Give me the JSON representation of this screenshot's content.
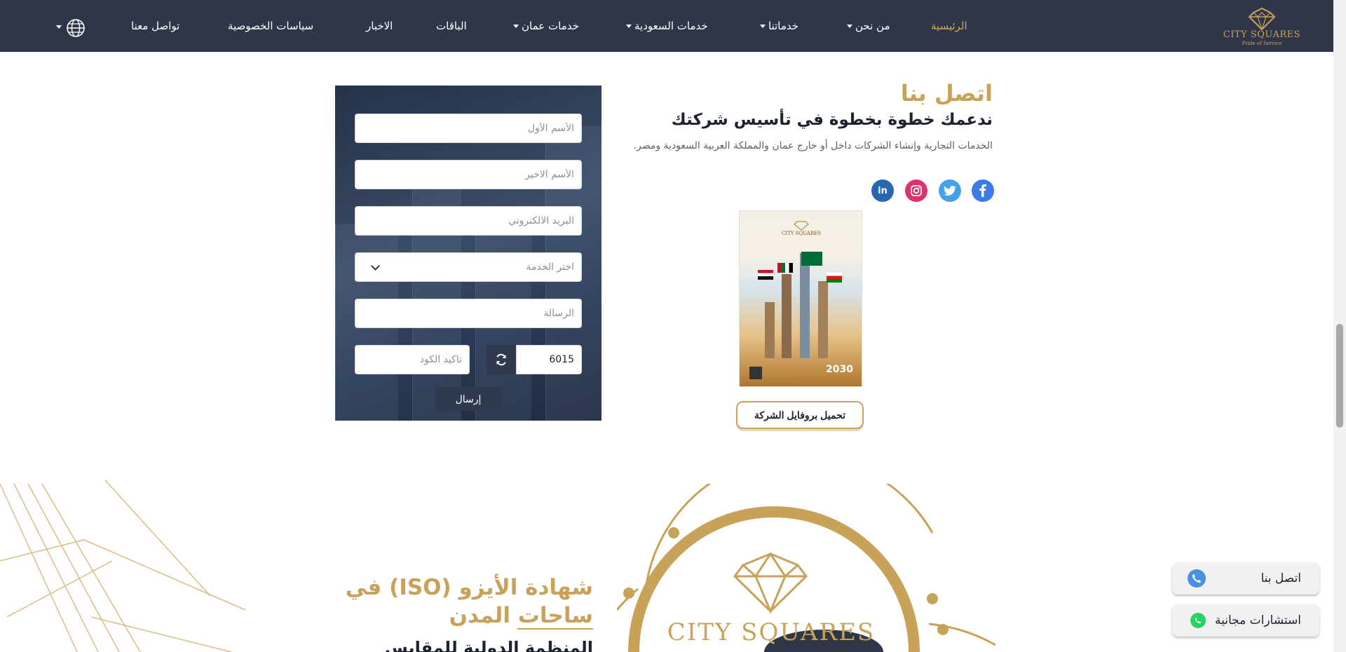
{
  "nav": {
    "brand": "CITY SQUARES",
    "tagline": "Pride of Service",
    "items": [
      {
        "label": "الرئيسية",
        "active": true
      },
      {
        "label": "من نحن",
        "dropdown": true
      },
      {
        "label": "خدماتنا",
        "dropdown": true
      },
      {
        "label": "خدمات السعودية",
        "dropdown": true
      },
      {
        "label": "خدمات عمان",
        "dropdown": true
      },
      {
        "label": "الباقات"
      },
      {
        "label": "الاخبار"
      },
      {
        "label": "سياسات الخصوصية"
      },
      {
        "label": "تواصل معنا"
      }
    ],
    "language_icon": "globe-icon"
  },
  "contact": {
    "title": "اتصل بنا",
    "subtitle": "ندعمك خطوة بخطوة في تأسيس شركتك",
    "description": "الخدمات التجارية وإنشاء الشركات داخل أو خارج عمان والمملكة العربية السعودية ومصر.",
    "socials": [
      "facebook-icon",
      "twitter-icon",
      "instagram-icon",
      "linkedin-icon"
    ],
    "brochure": {
      "brand": "CITY SQUARES",
      "year": "2030"
    },
    "download_label": "تحميل بروفايل الشركة"
  },
  "form": {
    "first_name_placeholder": "الأسم الأول",
    "last_name_placeholder": "الأسم الاخير",
    "email_placeholder": "البريد الالكتروني",
    "service_placeholder": "اختر الخدمة",
    "message_placeholder": "الرسالة",
    "captcha_code": "6015",
    "confirm_code_placeholder": "تاكيد الكود",
    "submit_label": "إرسال"
  },
  "iso": {
    "title": "شهادة الأيزو (ISO) في ساحات المدن",
    "subtitle": "المنظمة الدولية للمقايس",
    "emblem_brand": "CITY SQUARES"
  },
  "floating": {
    "contact_label": "اتصل بنا",
    "consult_label": "استشارات مجانية"
  },
  "colors": {
    "navbar": "#2f3647",
    "gold": "#c9a25a",
    "active_nav": "#d3a65c"
  }
}
